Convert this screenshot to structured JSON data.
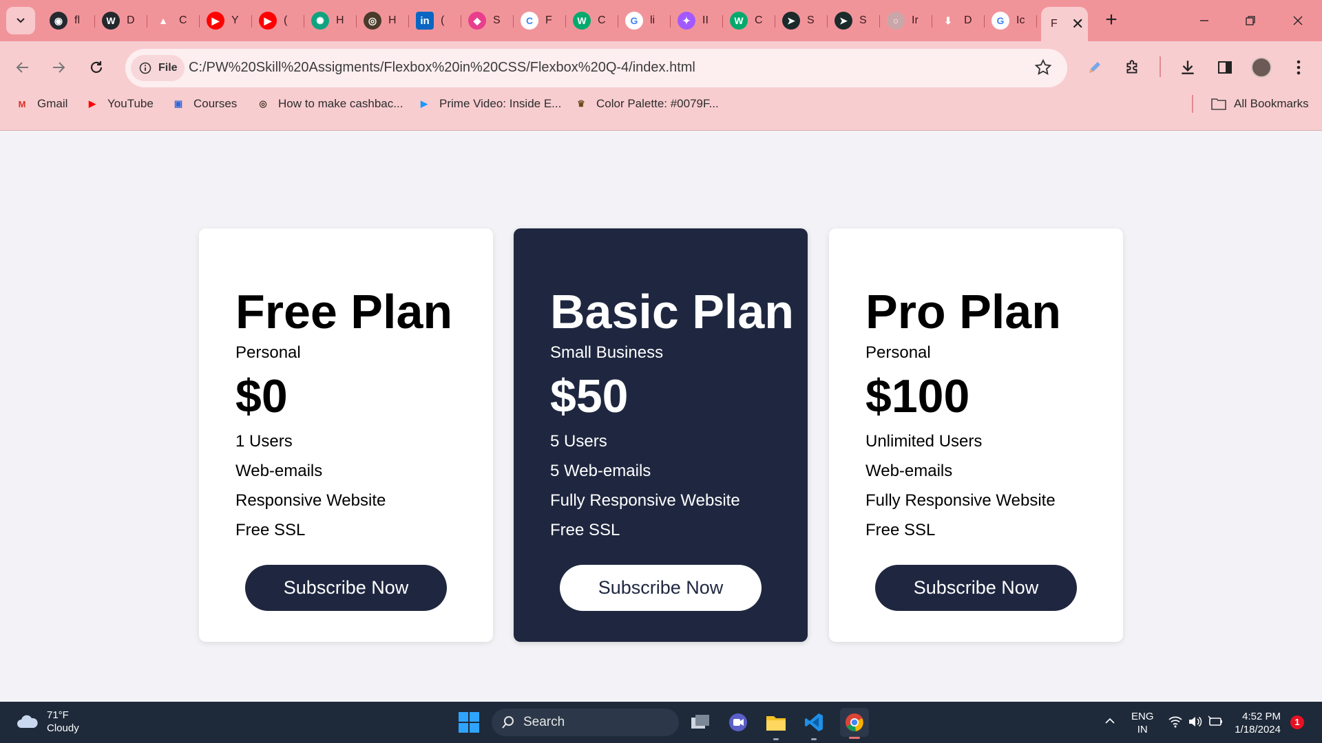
{
  "browser": {
    "tabs": [
      {
        "icon": "github-icon",
        "title": "fl",
        "bg": "#24292f",
        "glyph": "◉"
      },
      {
        "icon": "wordpress-icon",
        "title": "D",
        "bg": "#23282d",
        "glyph": "W"
      },
      {
        "icon": "google-drive-icon",
        "title": "C",
        "bg": "#f1949a",
        "glyph": "▲"
      },
      {
        "icon": "youtube-music-icon",
        "title": "Y",
        "bg": "#ff0000",
        "glyph": "▶"
      },
      {
        "icon": "youtube-icon",
        "title": "(",
        "bg": "#ff0000",
        "glyph": "▶"
      },
      {
        "icon": "chatgpt-icon",
        "title": "H",
        "bg": "#10a37f",
        "glyph": "✺"
      },
      {
        "icon": "cashback-site-icon",
        "title": "H",
        "bg": "#4a3a2a",
        "glyph": "◎"
      },
      {
        "icon": "linkedin-icon",
        "title": "(",
        "bg": "#0a66c2",
        "glyph": "in"
      },
      {
        "icon": "colorful-app-icon",
        "title": "S",
        "bg": "#e83e8c",
        "glyph": "◆"
      },
      {
        "icon": "c-site-icon",
        "title": "F",
        "bg": "#ffffff",
        "glyph": "C"
      },
      {
        "icon": "w3schools-icon",
        "title": "C",
        "bg": "#04aa6d",
        "glyph": "W"
      },
      {
        "icon": "google-icon",
        "title": "li",
        "bg": "#ffffff",
        "glyph": "G"
      },
      {
        "icon": "figma-icon",
        "title": "II",
        "bg": "#a259ff",
        "glyph": "✦"
      },
      {
        "icon": "w3schools-icon",
        "title": "C",
        "bg": "#04aa6d",
        "glyph": "W"
      },
      {
        "icon": "cursor-app-icon",
        "title": "S",
        "bg": "#1b2a2a",
        "glyph": "➤"
      },
      {
        "icon": "cursor-app-icon",
        "title": "S",
        "bg": "#1b2a2a",
        "glyph": "➤"
      },
      {
        "icon": "loading-icon",
        "title": "Ir",
        "bg": "#c9a6a8",
        "glyph": "○"
      },
      {
        "icon": "download-icon",
        "title": "D",
        "bg": "#f1949a",
        "glyph": "⬇"
      },
      {
        "icon": "google-icon",
        "title": "Ic",
        "bg": "#ffffff",
        "glyph": "G"
      }
    ],
    "active_tab": {
      "title": "F",
      "close": "✕"
    },
    "new_tab": "+",
    "chip_label": "File",
    "url": "C:/PW%20Skill%20Assigments/Flexbox%20in%20CSS/Flexbox%20Q-4/index.html",
    "bookmarks": [
      {
        "label": "Gmail",
        "icon": "gmail-icon",
        "glyph": "M",
        "color": "#d93025"
      },
      {
        "label": "YouTube",
        "icon": "youtube-icon",
        "glyph": "▶",
        "color": "#ff0000"
      },
      {
        "label": "Courses",
        "icon": "courses-icon",
        "glyph": "▣",
        "color": "#3367d6"
      },
      {
        "label": "How to make cashbac...",
        "icon": "cashback-site-icon",
        "glyph": "◎",
        "color": "#4a3a2a"
      },
      {
        "label": "Prime Video: Inside E...",
        "icon": "prime-video-icon",
        "glyph": "▶",
        "color": "#1a98ff"
      },
      {
        "label": "Color Palette: #0079F...",
        "icon": "color-palette-icon",
        "glyph": "♛",
        "color": "#6b4b1b"
      }
    ],
    "all_bookmarks": "All Bookmarks"
  },
  "plans": [
    {
      "name": "Free Plan",
      "tier": "Personal",
      "price": "$0",
      "features": [
        "1 Users",
        "Web-emails",
        "Responsive Website",
        "Free SSL"
      ],
      "button": "Subscribe Now"
    },
    {
      "name": "Basic Plan",
      "tier": "Small Business",
      "price": "$50",
      "features": [
        "5 Users",
        "5 Web-emails",
        "Fully Responsive Website",
        "Free SSL"
      ],
      "button": "Subscribe Now"
    },
    {
      "name": "Pro Plan",
      "tier": "Personal",
      "price": "$100",
      "features": [
        "Unlimited Users",
        "Web-emails",
        "Fully Responsive Website",
        "Free SSL"
      ],
      "button": "Subscribe Now"
    }
  ],
  "taskbar": {
    "temperature": "71°F",
    "condition": "Cloudy",
    "search_label": "Search",
    "lang_top": "ENG",
    "lang_bottom": "IN",
    "time": "4:52 PM",
    "date": "1/18/2024",
    "notifications": "1"
  },
  "colors": {
    "dark_card": "#1f2740",
    "tab_strip": "#f1949a",
    "toolbar": "#f8cdd0",
    "page_bg": "#f3f3f7"
  }
}
